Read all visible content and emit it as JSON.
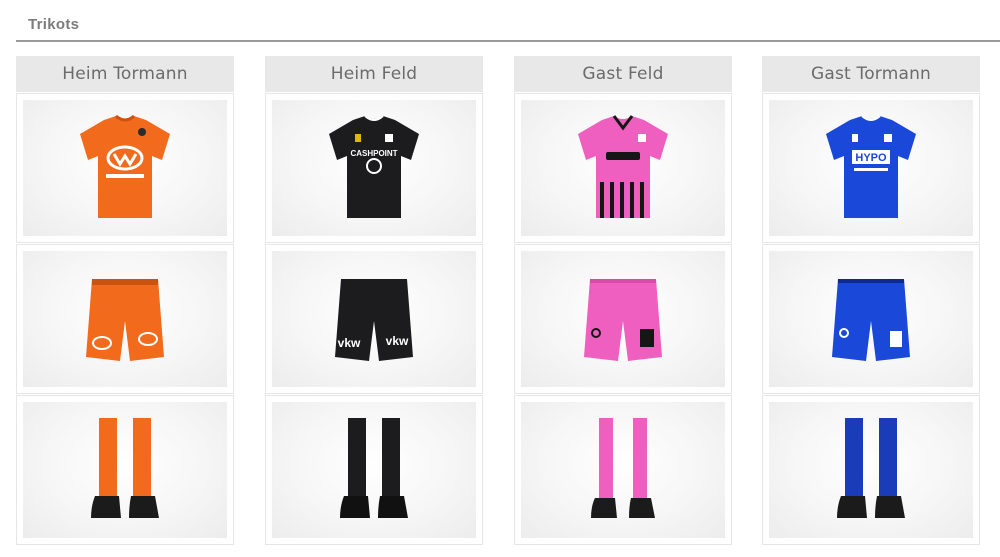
{
  "section": {
    "title": "Trikots"
  },
  "columns": [
    {
      "label": "Heim Tormann",
      "colors": {
        "main": "#f26a1b",
        "dark": "#c9530f",
        "accent": "#ffffff"
      },
      "sponsor": "",
      "short_sponsor": ""
    },
    {
      "label": "Heim Feld",
      "colors": {
        "main": "#1c1c1e",
        "dark": "#000000",
        "accent": "#ffffff"
      },
      "sponsor": "CASHPOINT",
      "short_sponsor": "vkw"
    },
    {
      "label": "Gast Feld",
      "colors": {
        "main": "#ef5fbf",
        "dark": "#161616",
        "accent": "#ffffff"
      },
      "sponsor": "",
      "short_sponsor": ""
    },
    {
      "label": "Gast Tormann",
      "colors": {
        "main": "#1a48d8",
        "dark": "#0d2a8f",
        "accent": "#ffffff"
      },
      "sponsor": "HYPO",
      "short_sponsor": ""
    }
  ],
  "items": [
    "jersey",
    "shorts",
    "socks"
  ]
}
